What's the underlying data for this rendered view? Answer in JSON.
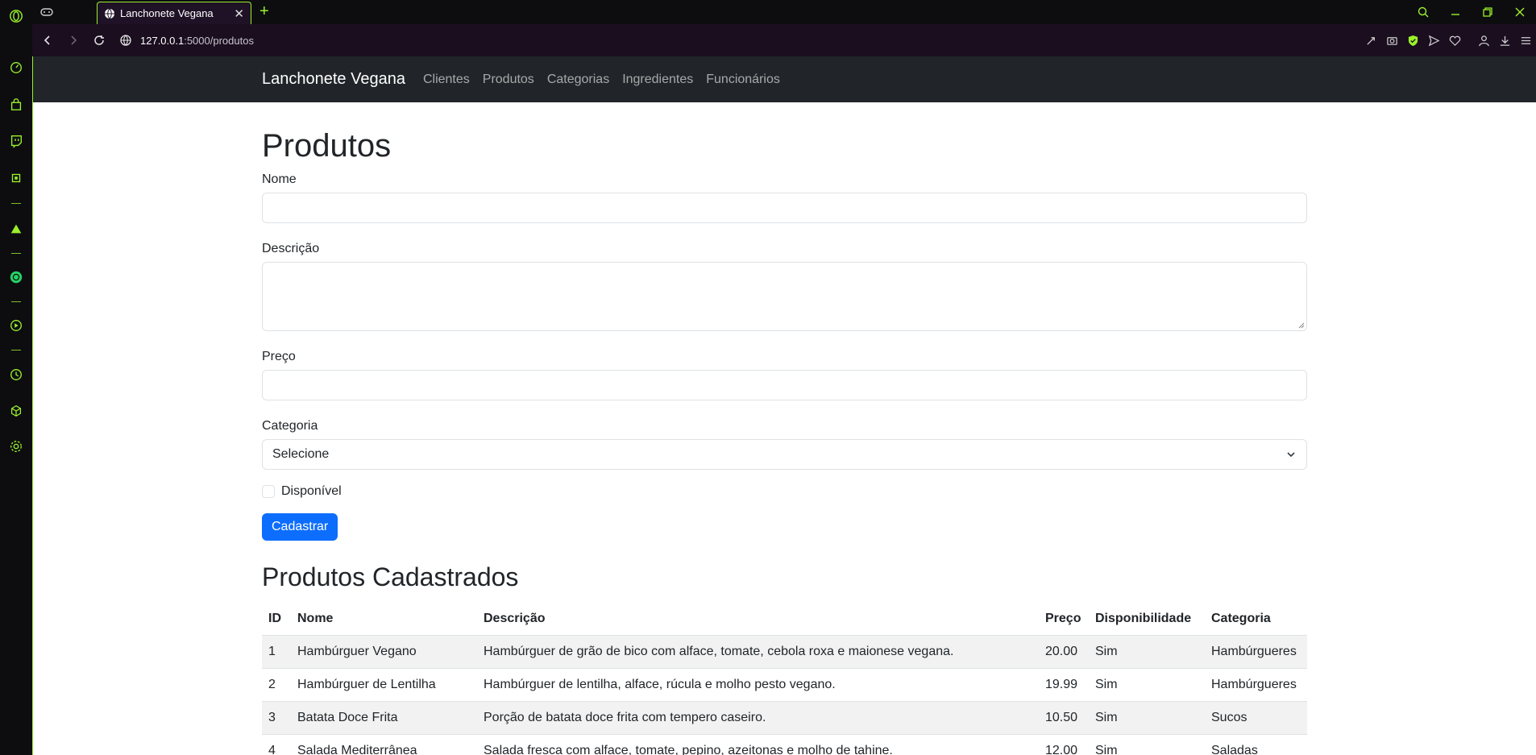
{
  "browser": {
    "tab_title": "Lanchonete Vegana",
    "url_host": "127.0.0.1",
    "url_path": ":5000/produtos",
    "accent_color": "#9af02a"
  },
  "navbar": {
    "brand": "Lanchonete Vegana",
    "links": [
      "Clientes",
      "Produtos",
      "Categorias",
      "Ingredientes",
      "Funcionários"
    ]
  },
  "form": {
    "title": "Produtos",
    "nome_label": "Nome",
    "nome_value": "",
    "descricao_label": "Descrição",
    "descricao_value": "",
    "preco_label": "Preço",
    "preco_value": "",
    "categoria_label": "Categoria",
    "categoria_selected": "Selecione",
    "disponivel_label": "Disponível",
    "submit_label": "Cadastrar"
  },
  "table": {
    "title": "Produtos Cadastrados",
    "headers": [
      "ID",
      "Nome",
      "Descrição",
      "Preço",
      "Disponibilidade",
      "Categoria"
    ],
    "rows": [
      [
        "1",
        "Hambúrguer Vegano",
        "Hambúrguer de grão de bico com alface, tomate, cebola roxa e maionese vegana.",
        "20.00",
        "Sim",
        "Hambúrgueres"
      ],
      [
        "2",
        "Hambúrguer de Lentilha",
        "Hambúrguer de lentilha, alface, rúcula e molho pesto vegano.",
        "19.99",
        "Sim",
        "Hambúrgueres"
      ],
      [
        "3",
        "Batata Doce Frita",
        "Porção de batata doce frita com tempero caseiro.",
        "10.50",
        "Sim",
        "Sucos"
      ],
      [
        "4",
        "Salada Mediterrânea",
        "Salada fresca com alface, tomate, pepino, azeitonas e molho de tahine.",
        "12.00",
        "Sim",
        "Saladas"
      ]
    ]
  }
}
